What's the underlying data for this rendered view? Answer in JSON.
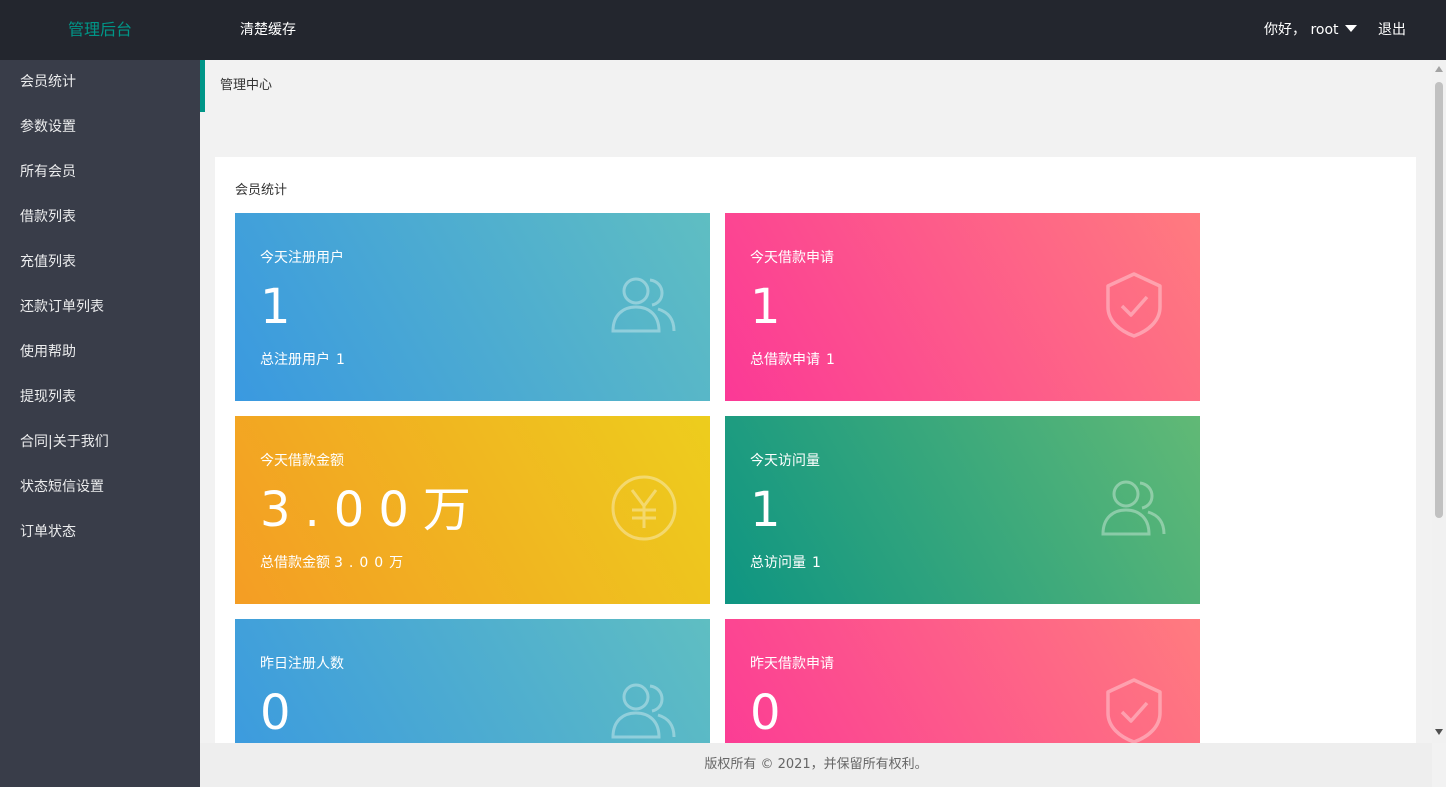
{
  "header": {
    "logo": "管理后台",
    "clear_cache": "清楚缓存",
    "greeting": "你好， root",
    "logout": "退出"
  },
  "sidebar": {
    "items": [
      {
        "label": "会员统计"
      },
      {
        "label": "参数设置"
      },
      {
        "label": "所有会员"
      },
      {
        "label": "借款列表"
      },
      {
        "label": "充值列表"
      },
      {
        "label": "还款订单列表"
      },
      {
        "label": "使用帮助"
      },
      {
        "label": "提现列表"
      },
      {
        "label": "合同|关于我们"
      },
      {
        "label": "状态短信设置"
      },
      {
        "label": "订单状态"
      }
    ]
  },
  "breadcrumb": "管理中心",
  "panel": {
    "title": "会员统计",
    "cards": [
      {
        "label": "今天注册用户",
        "value": "1",
        "total_label": "总注册用户",
        "total_value": "1",
        "icon": "users-icon",
        "color": "#3a99e0"
      },
      {
        "label": "今天借款申请",
        "value": "1",
        "total_label": "总借款申请",
        "total_value": "1",
        "icon": "shield-check-icon",
        "color": "#fb3996"
      },
      {
        "label": "今天借款金额",
        "value": "3.00万",
        "total_label": "总借款金额",
        "total_value": "3.00万",
        "icon": "yuan-icon",
        "color": "#f49d24"
      },
      {
        "label": "今天访问量",
        "value": "1",
        "total_label": "总访问量",
        "total_value": "1",
        "icon": "users-icon",
        "color": "#0e9582"
      },
      {
        "label": "昨日注册人数",
        "value": "0",
        "icon": "users-icon",
        "color": "#3a99e0"
      },
      {
        "label": "昨天借款申请",
        "value": "0",
        "icon": "shield-check-icon",
        "color": "#fb3996"
      }
    ]
  },
  "footer": "版权所有 © 2021，并保留所有权利。"
}
